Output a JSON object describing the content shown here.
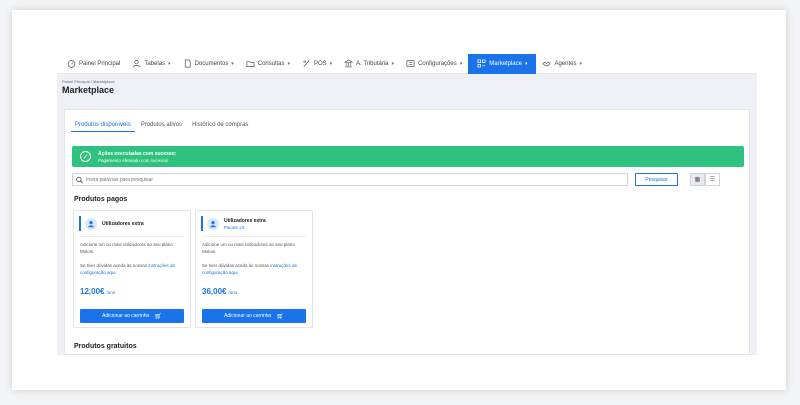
{
  "nav": {
    "items": [
      {
        "label": "Painel Principal",
        "icon": "gauge-icon",
        "dropdown": false
      },
      {
        "label": "Tabelas",
        "icon": "user-icon",
        "dropdown": true
      },
      {
        "label": "Documentos",
        "icon": "document-icon",
        "dropdown": true
      },
      {
        "label": "Consultas",
        "icon": "folder-icon",
        "dropdown": true
      },
      {
        "label": "POS",
        "icon": "pos-icon",
        "dropdown": true
      },
      {
        "label": "A. Tributária",
        "icon": "bank-icon",
        "dropdown": true
      },
      {
        "label": "Configurações",
        "icon": "settings-icon",
        "dropdown": true
      },
      {
        "label": "Marketplace",
        "icon": "marketplace-icon",
        "dropdown": true
      },
      {
        "label": "Agentes",
        "icon": "handshake-icon",
        "dropdown": true
      }
    ],
    "active": "Marketplace",
    "accent": "#1a73e8"
  },
  "breadcrumb": {
    "home": "Painel Principal",
    "separator": "/",
    "current": "Marketplace"
  },
  "page_title": "Marketplace",
  "tabs": [
    {
      "label": "Produtos disponíveis",
      "active": true
    },
    {
      "label": "Produtos ativos",
      "active": false
    },
    {
      "label": "Histórico de compras",
      "active": false
    }
  ],
  "alert": {
    "title": "Ações executadas com sucesso:",
    "message": "Pagamento efetuado com sucesso!",
    "color": "#2ec27e"
  },
  "search": {
    "placeholder": "Insira palavras para pesquisar",
    "button_label": "Pesquisar"
  },
  "sections": {
    "paid": "Produtos pagos",
    "free": "Produtos gratuitos"
  },
  "products": [
    {
      "name": "Utilizadores extra",
      "subtitle": "",
      "description": "Adicione um ou mais utilizadores ao seu plano Moloni.",
      "help_prefix": "Se tiver dúvidas aceda às nossas ",
      "help_link": "instruções de configuração aqui.",
      "price": "12,00€",
      "unit": "/uno",
      "button_label": "Adicionar ao carrinho"
    },
    {
      "name": "Utilizadores extra",
      "subtitle": "Pacote x3",
      "description": "Adicione um ou mais utilizadores ao seu plano Moloni.",
      "help_prefix": "Se tiver dúvidas aceda às nossas ",
      "help_link": "instruções de configuração aqui.",
      "price": "36,00€",
      "unit": "/uno",
      "button_label": "Adicionar ao carrinho"
    }
  ]
}
